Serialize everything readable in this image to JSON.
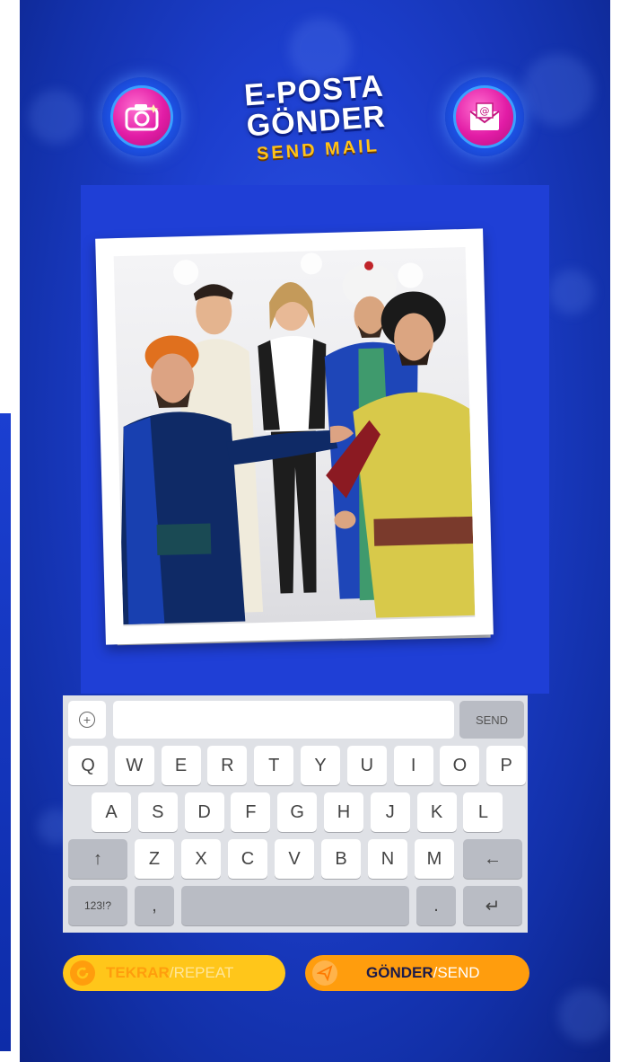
{
  "header": {
    "title_line1": "E-POSTA",
    "title_line2": "GÖNDER",
    "subtitle": "SEND MAIL",
    "left_button_icon": "camera-icon",
    "right_button_icon": "email-icon"
  },
  "keyboard": {
    "send_label": "SEND",
    "plus_icon": "plus-circle-icon",
    "row1": [
      "Q",
      "W",
      "E",
      "R",
      "T",
      "Y",
      "U",
      "I",
      "O",
      "P"
    ],
    "row2": [
      "A",
      "S",
      "D",
      "F",
      "G",
      "H",
      "J",
      "K",
      "L"
    ],
    "row3": [
      "Z",
      "X",
      "C",
      "V",
      "B",
      "N",
      "M"
    ],
    "shift_label": "↑",
    "backspace_label": "←",
    "numbers_label": "123!?",
    "comma_label": ",",
    "period_label": ".",
    "enter_label": "↵"
  },
  "actions": {
    "repeat_tr": "TEKRAR",
    "repeat_en": "/REPEAT",
    "send_tr": "GÖNDER",
    "send_en": "/SEND"
  },
  "colors": {
    "background": "#1d3fcf",
    "accent_yellow": "#ffc61a",
    "accent_orange": "#ff9d0d",
    "magenta": "#e21ca6"
  }
}
